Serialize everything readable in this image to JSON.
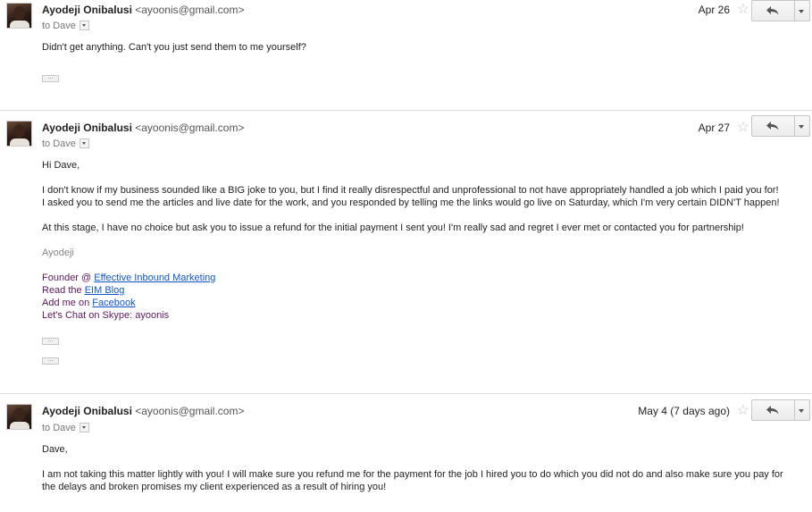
{
  "messages": [
    {
      "sender_name": "Ayodeji Onibalusi",
      "sender_email": "<ayoonis@gmail.com>",
      "to": "to Dave",
      "date": "Apr 26",
      "body": [
        "Didn't get anything. Can't you just send them to me yourself?"
      ]
    },
    {
      "sender_name": "Ayodeji Onibalusi",
      "sender_email": "<ayoonis@gmail.com>",
      "to": "to Dave",
      "date": "Apr 27",
      "greeting": "Hi Dave,",
      "para1_line1": "I don't know if my business sounded like a BIG joke to you, but I find it really disrespectful and unprofessional to not have appropriately handled a job which I paid you for!",
      "para1_line2": "I asked you to send me the articles and live date for the work, and you responded by telling me the links would go live on Saturday, which I'm very certain DIDN'T happen!",
      "para2": "At this stage, I have no choice but ask you to issue a refund for the initial payment I sent you! I'm really sad and regret I ever met or contacted you for partnership!",
      "sig_name": "Ayodeji",
      "sig_founder_prefix": "Founder @ ",
      "sig_founder_link": "Effective Inbound Marketing",
      "sig_read_prefix": "Read the ",
      "sig_read_link": "EIM Blog",
      "sig_add_prefix": "Add me on ",
      "sig_add_link": "Facebook",
      "sig_skype": "Let's Chat on Skype: ayoonis"
    },
    {
      "sender_name": "Ayodeji Onibalusi",
      "sender_email": "<ayoonis@gmail.com>",
      "to": "to Dave",
      "date": "May 4 (7 days ago)",
      "greeting": "Dave,",
      "para1": "I am not taking this matter lightly with you! I will make sure you refund me for the payment for the job I hired you to do which you did not do and also make sure you pay for the delays and broken promises my client experienced as a result of hiring you!"
    }
  ],
  "ellipsis_label": "...",
  "icons": {
    "star": "star-icon",
    "reply": "reply-icon",
    "more": "chevron-down-icon"
  }
}
